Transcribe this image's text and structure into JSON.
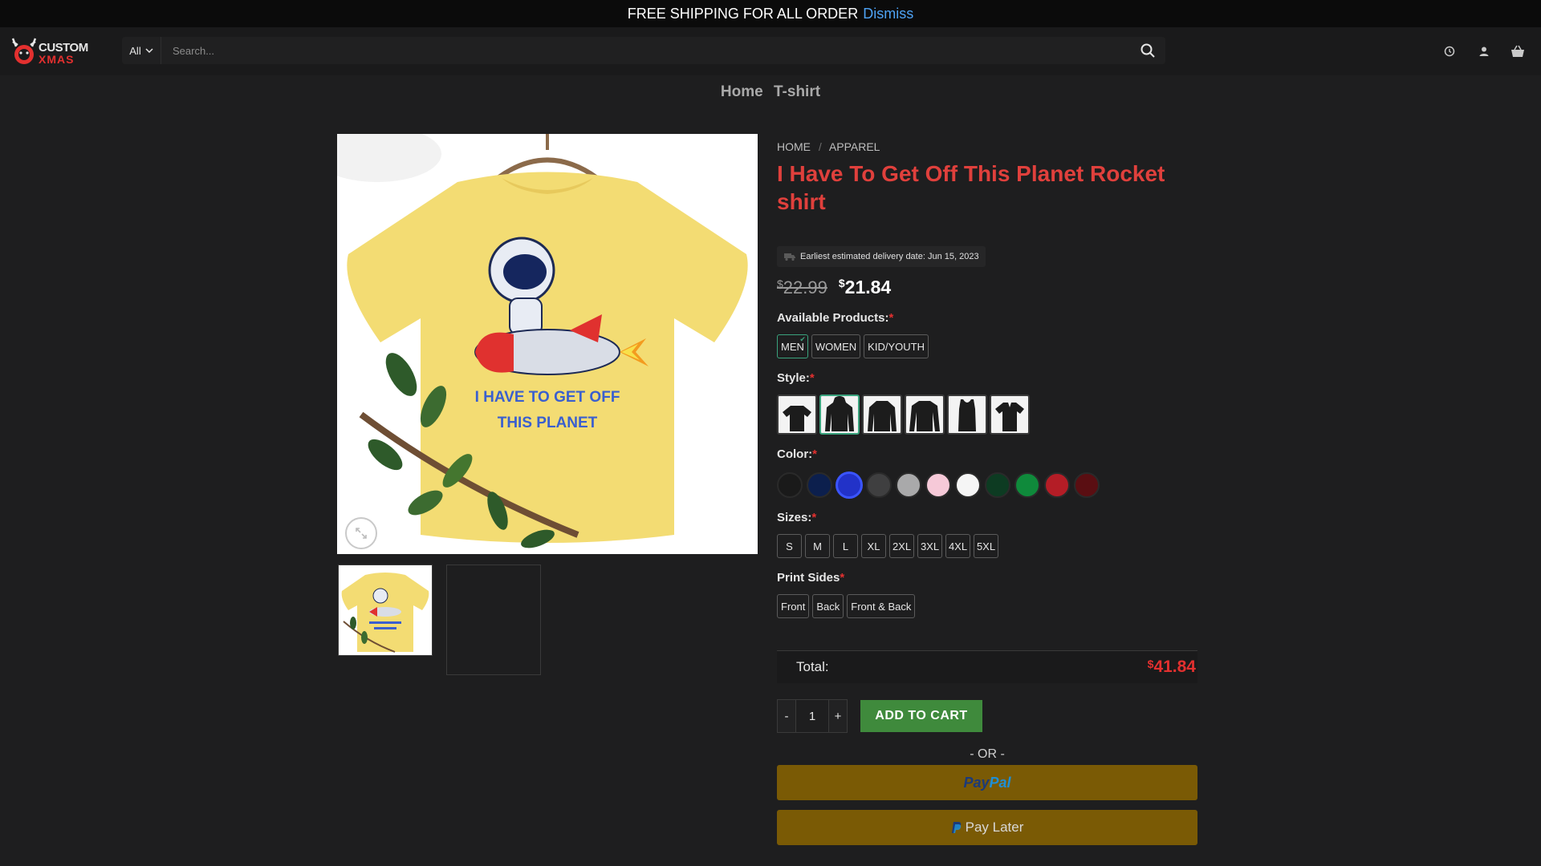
{
  "announcement": {
    "text": "FREE SHIPPING FOR ALL ORDER",
    "dismiss": "Dismiss"
  },
  "header": {
    "logo_line1": "CUSTOM",
    "logo_line2": "XMAS",
    "category": "All",
    "search_placeholder": "Search..."
  },
  "nav": {
    "home": "Home",
    "tshirt": "T-shirt"
  },
  "breadcrumb": {
    "home": "HOME",
    "sep": "/",
    "apparel": "APPAREL"
  },
  "product": {
    "title": "I Have To Get Off This Planet Rocket shirt",
    "delivery": "Earliest estimated delivery date: Jun 15, 2023",
    "currency": "$",
    "old_price": "22.99",
    "new_price": "21.84",
    "shirt_text_line1": "I HAVE TO GET OFF",
    "shirt_text_line2": "THIS PLANET"
  },
  "available_products": {
    "label": "Available Products:",
    "required": "*",
    "options": [
      "MEN",
      "WOMEN",
      "KID/YOUTH"
    ],
    "selected": "MEN"
  },
  "style": {
    "label": "Style:",
    "required": "*",
    "options": [
      "t-shirt",
      "hoodie",
      "sweatshirt",
      "long-sleeve",
      "tank-top",
      "v-neck"
    ],
    "selected": "hoodie"
  },
  "color": {
    "label": "Color:",
    "required": "*",
    "swatches": [
      "#1a1a1a",
      "#0c1f4d",
      "#2232c8",
      "#3f3f40",
      "#a9a9aa",
      "#f6c9d8",
      "#f5f5f5",
      "#0d3b22",
      "#0f8a3b",
      "#b41d26",
      "#5a0e12"
    ],
    "selected_index": 2
  },
  "sizes": {
    "label": "Sizes:",
    "required": "*",
    "options": [
      "S",
      "M",
      "L",
      "XL",
      "2XL",
      "3XL",
      "4XL",
      "5XL"
    ]
  },
  "print_sides": {
    "label": "Print Sides",
    "required": "*",
    "options": [
      "Front",
      "Back",
      "Front & Back"
    ]
  },
  "total": {
    "label": "Total:",
    "currency": "$",
    "value": "41.84"
  },
  "cart": {
    "minus": "-",
    "quantity": "1",
    "plus": "+",
    "add_label": "ADD TO CART"
  },
  "or_text": "- OR -",
  "paypal": {
    "pay": "Pay",
    "pal": "Pal",
    "pay_later": "Pay Later"
  },
  "colors": {
    "accent_red": "#e0403c",
    "cart_green": "#3f8a3c",
    "paypal_gold": "#7a5a05",
    "selected_green": "#3aa37d"
  }
}
